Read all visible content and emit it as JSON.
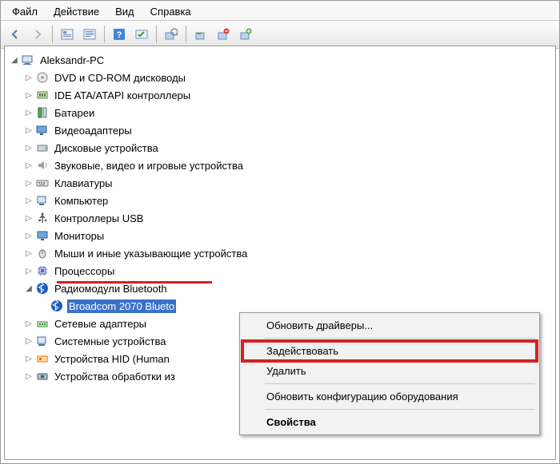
{
  "menu": {
    "file": "Файл",
    "action": "Действие",
    "view": "Вид",
    "help": "Справка"
  },
  "tree": {
    "root": "Aleksandr-PC",
    "items": [
      "DVD и CD-ROM дисководы",
      "IDE ATA/ATAPI контроллеры",
      "Батареи",
      "Видеоадаптеры",
      "Дисковые устройства",
      "Звуковые, видео и игровые устройства",
      "Клавиатуры",
      "Компьютер",
      "Контроллеры USB",
      "Мониторы",
      "Мыши и иные указывающие устройства",
      "Процессоры",
      "Радиомодули Bluetooth",
      "Сетевые адаптеры",
      "Системные устройства",
      "Устройства HID (Human",
      "Устройства обработки из"
    ],
    "bt_leaf": "Broadcom 2070 Blueto"
  },
  "context_menu": {
    "update_drivers": "Обновить драйверы...",
    "enable": "Задействовать",
    "delete": "Удалить",
    "scan_hw": "Обновить конфигурацию оборудования",
    "properties": "Свойства"
  }
}
